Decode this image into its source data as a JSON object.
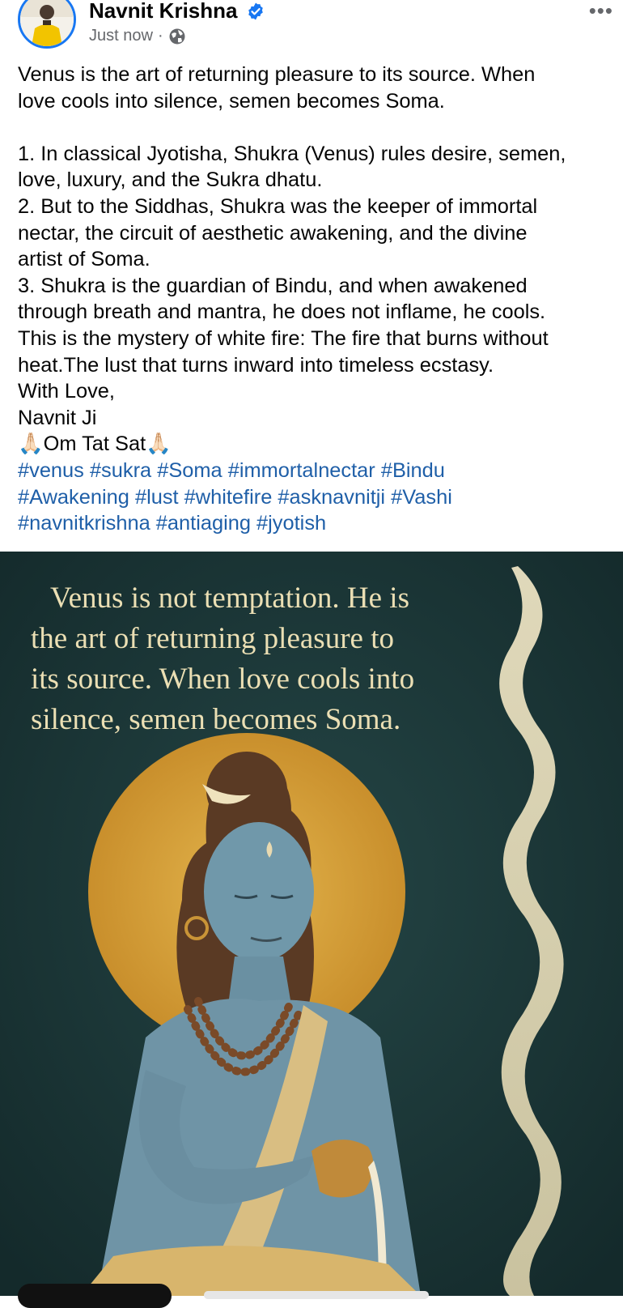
{
  "post": {
    "author": "Navnit Krishna",
    "timestamp": "Just now",
    "separator": "·",
    "more_label": "•••",
    "icons": {
      "verified": "verified-badge-icon",
      "audience": "globe-icon",
      "more": "more-dots-icon"
    },
    "body": {
      "intro": [
        "Venus is the art of returning pleasure to its source. When",
        "love cools into silence, semen becomes Soma."
      ],
      "points": [
        "1. In classical Jyotisha, Shukra (Venus) rules desire, semen,",
        "love, luxury, and the Sukra dhatu.",
        "2. But to the Siddhas, Shukra was the keeper of immortal",
        "nectar, the circuit of aesthetic awakening, and the divine",
        "artist of Soma.",
        "3. Shukra is the guardian of Bindu, and when awakened",
        "through breath and mantra, he does not inflame, he cools.",
        "This is the mystery of white fire: The fire that burns without",
        "heat.The lust that turns inward into timeless ecstasy."
      ],
      "closing": [
        "With Love,",
        "Navnit Ji"
      ],
      "mantra": "🙏🏻Om Tat Sat🙏🏻"
    },
    "hashtags": [
      [
        "#venus",
        "#sukra",
        "#Soma",
        "#immortalnectar",
        "#Bindu"
      ],
      [
        "#Awakening",
        "#lust",
        "#whitefire",
        "#asknavnitji",
        "#Vashi"
      ],
      [
        "#navnitkrishna",
        "#antiaging",
        "#jyotish"
      ]
    ],
    "image_quote": [
      "Venus is not temptation. He is",
      "the art of returning pleasure to",
      "its source. When love cools into",
      "silence, semen becomes Soma."
    ]
  },
  "colors": {
    "verified": "#1877f2",
    "hashtag": "#1f5fa8",
    "meta_text": "#65676b",
    "image_background": "#1d3a3a",
    "halo": "#d9a441",
    "skin": "#6f93a6",
    "quote_text": "#ebdfb4"
  }
}
